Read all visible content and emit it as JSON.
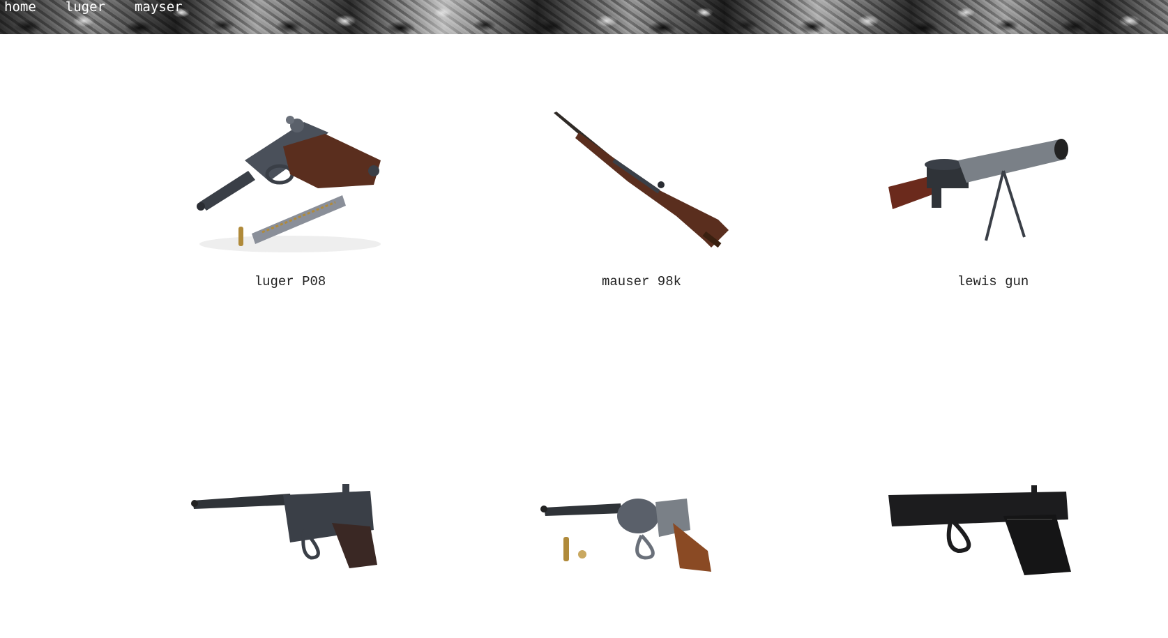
{
  "nav": {
    "items": [
      {
        "label": "home"
      },
      {
        "label": "luger"
      },
      {
        "label": "mayser"
      }
    ]
  },
  "gallery": {
    "items": [
      {
        "caption": "luger P08",
        "icon": "luger-pistol-image"
      },
      {
        "caption": "mauser 98k",
        "icon": "mauser-rifle-image"
      },
      {
        "caption": "lewis gun",
        "icon": "lewis-machine-gun-image"
      },
      {
        "caption": "",
        "icon": "mauser-c96-pistol-image"
      },
      {
        "caption": "",
        "icon": "nagant-revolver-image"
      },
      {
        "caption": "",
        "icon": "colt-1911-pistol-image"
      }
    ]
  },
  "colors": {
    "wood": "#5a2e1e",
    "metal": "#3a3f47",
    "brass": "#b08a3a"
  }
}
